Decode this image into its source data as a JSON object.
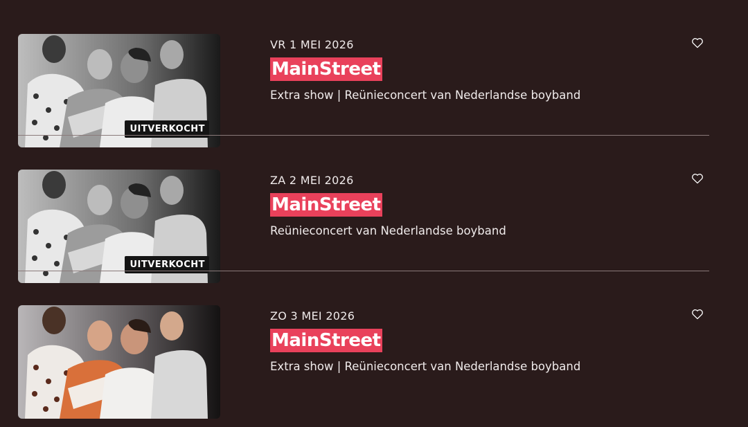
{
  "events": [
    {
      "date": "VR 1 MEI 2026",
      "title": "MainStreet",
      "subtitle": "Extra show | Reünieconcert van Nederlandse boyband",
      "badge": "UITVERKOCHT",
      "image_style": "grayscale",
      "favorite_icon": "heart-outline-icon"
    },
    {
      "date": "ZA 2 MEI 2026",
      "title": "MainStreet",
      "subtitle": "Reünieconcert van Nederlandse boyband",
      "badge": "UITVERKOCHT",
      "image_style": "grayscale",
      "favorite_icon": "heart-outline-icon"
    },
    {
      "date": "ZO 3 MEI 2026",
      "title": "MainStreet",
      "subtitle": "Extra show | Reünieconcert van Nederlandse boyband",
      "badge": "",
      "image_style": "color",
      "favorite_icon": "heart-outline-icon"
    }
  ],
  "colors": {
    "background": "#2a1b1b",
    "title_highlight": "#e9415b",
    "separator": "#8a7a7a",
    "badge_bg": "#141414"
  }
}
